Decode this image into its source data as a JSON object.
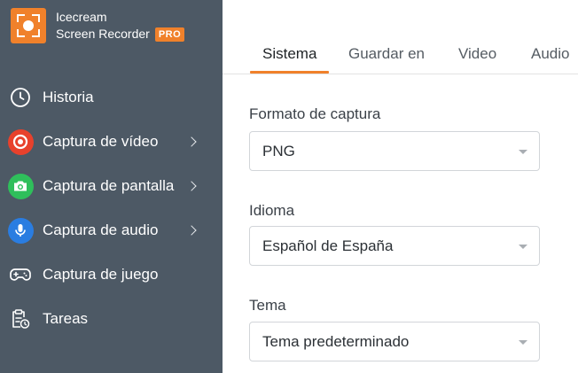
{
  "app": {
    "name_line1": "Icecream",
    "name_line2": "Screen Recorder",
    "badge": "PRO",
    "accent_color": "#f0812b"
  },
  "sidebar": {
    "items": [
      {
        "label": "Historia",
        "icon": "clock-icon"
      },
      {
        "label": "Captura de vídeo",
        "icon": "record-icon",
        "has_submenu": true,
        "icon_color": "#e8412c"
      },
      {
        "label": "Captura de pantalla",
        "icon": "camera-icon",
        "has_submenu": true,
        "icon_color": "#2fbf5b"
      },
      {
        "label": "Captura de audio",
        "icon": "microphone-icon",
        "has_submenu": true,
        "icon_color": "#2a7de1"
      },
      {
        "label": "Captura de juego",
        "icon": "gamepad-icon"
      },
      {
        "label": "Tareas",
        "icon": "tasks-icon"
      }
    ]
  },
  "tabs": [
    {
      "label": "Sistema",
      "active": true
    },
    {
      "label": "Guardar en"
    },
    {
      "label": "Video"
    },
    {
      "label": "Audio"
    }
  ],
  "settings": {
    "capture_format": {
      "label": "Formato de captura",
      "value": "PNG"
    },
    "language": {
      "label": "Idioma",
      "value": "Español de España"
    },
    "theme": {
      "label": "Tema",
      "value": "Tema predeterminado"
    }
  }
}
